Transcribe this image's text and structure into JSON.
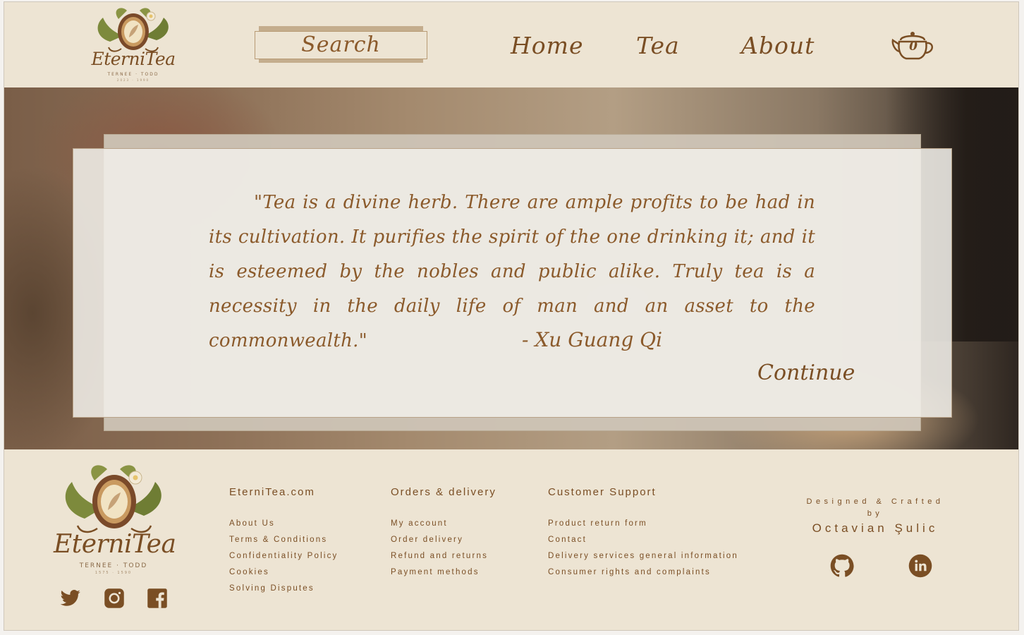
{
  "header": {
    "logo": {
      "brand": "EterniTea",
      "subtitle": "TERNEE · TODD",
      "year": "2023 · 1990"
    },
    "search_label": "Search",
    "nav": [
      {
        "label": "Home"
      },
      {
        "label": "Tea"
      },
      {
        "label": "About"
      }
    ],
    "cart_count": "0"
  },
  "hero": {
    "quote": "\"Tea is a divine herb. There are ample profits to be had in its cultivation. It purifies the spirit of the one drinking it; and it is esteemed by the nobles and public alike. Truly tea is a necessity in the daily life of man and an asset to the commonwealth.\"",
    "author": "- Xu Guang Qi",
    "continue_label": "Continue"
  },
  "footer": {
    "logo": {
      "brand": "EterniTea",
      "subtitle": "TERNEE · TODD",
      "year": "1575 · 1590"
    },
    "social": [
      "twitter-icon",
      "instagram-icon",
      "facebook-icon"
    ],
    "columns": [
      {
        "title": "EterniTea.com",
        "links": [
          "About Us",
          "Terms & Conditions",
          "Confidentiality Policy",
          "Cookies",
          "Solving Disputes"
        ]
      },
      {
        "title": "Orders & delivery",
        "links": [
          "My account",
          "Order delivery",
          "Refund and returns",
          "Payment methods"
        ]
      },
      {
        "title": "Customer Support",
        "links": [
          "Product return form",
          "Contact",
          "Delivery services general information",
          "Consumer rights and complaints"
        ]
      }
    ],
    "credits": {
      "line1": "Designed & Crafted",
      "line2": "by",
      "author": "Octavian Şulic"
    },
    "external": [
      "github-icon",
      "linkedin-icon"
    ]
  },
  "colors": {
    "background": "#ede4d3",
    "accent": "#7a4e24",
    "search_shadow": "#c4ad8d"
  }
}
